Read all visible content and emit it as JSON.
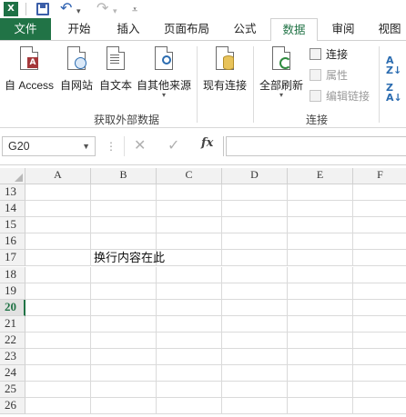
{
  "qat": {
    "undo_icon": "undo-icon",
    "redo_icon": "redo-icon",
    "more_icon": "customize-icon"
  },
  "tabs": [
    {
      "label": "文件",
      "kind": "file"
    },
    {
      "label": "开始"
    },
    {
      "label": "插入"
    },
    {
      "label": "页面布局"
    },
    {
      "label": "公式"
    },
    {
      "label": "数据",
      "active": true
    },
    {
      "label": "审阅"
    },
    {
      "label": "视图"
    }
  ],
  "ribbon": {
    "get_external": {
      "access": "自 Access",
      "web": "自网站",
      "text": "自文本",
      "other": "自其他来源",
      "group_label": "获取外部数据"
    },
    "existing": "现有连接",
    "connections": {
      "refresh_all": "全部刷新",
      "connections": "连接",
      "properties": "属性",
      "edit_links": "编辑链接",
      "group_label": "连接"
    }
  },
  "formula_bar": {
    "name_box": "G20",
    "cancel": "✕",
    "enter": "✓",
    "fx": "fx",
    "value": ""
  },
  "sheet": {
    "columns": [
      "A",
      "B",
      "C",
      "D",
      "E",
      "F"
    ],
    "rows": [
      "13",
      "14",
      "15",
      "16",
      "17",
      "18",
      "19",
      "20",
      "21",
      "22",
      "23",
      "24",
      "25",
      "26"
    ],
    "selected_row": "20",
    "cell_text": "换行内容在此"
  }
}
